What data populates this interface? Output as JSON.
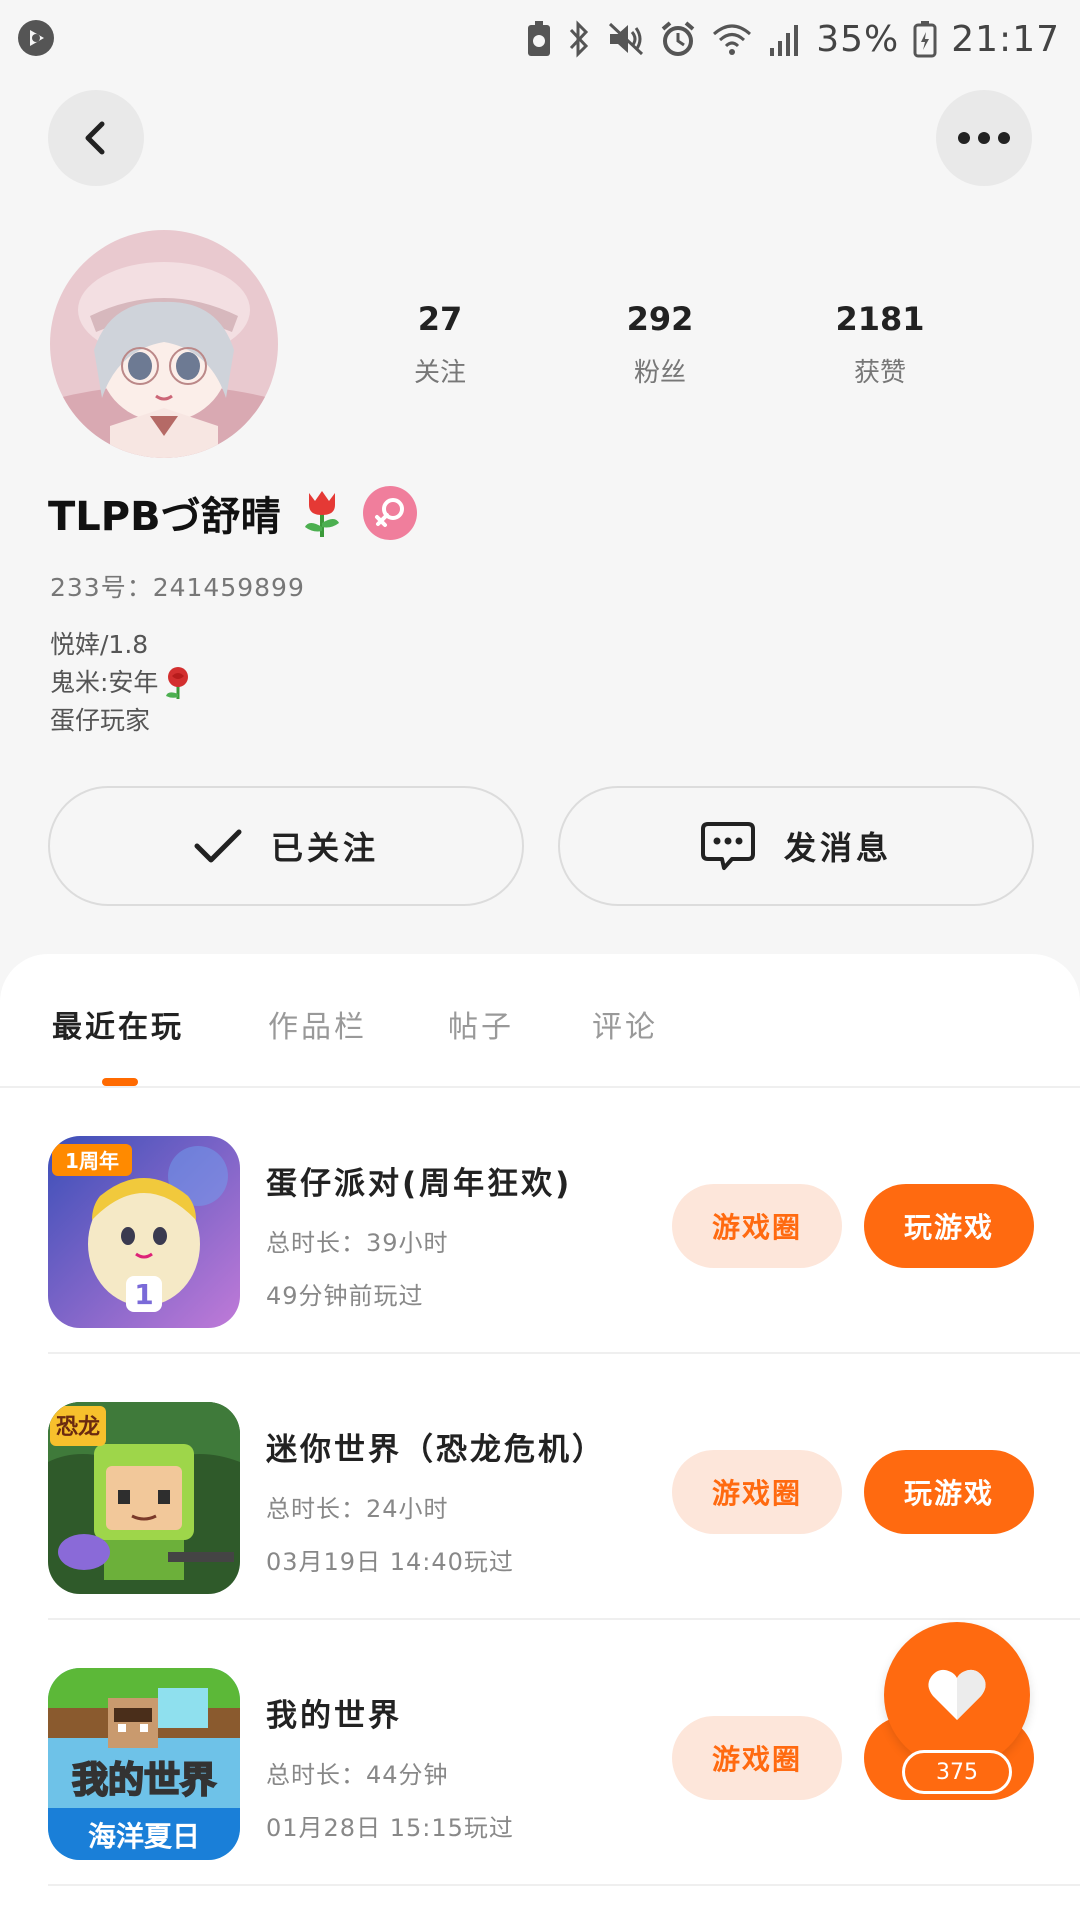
{
  "status_bar": {
    "battery": "35%",
    "time": "21:17"
  },
  "profile": {
    "following_count": "27",
    "following_label": "关注",
    "fans_count": "292",
    "fans_label": "粉丝",
    "likes_count": "2181",
    "likes_label": "获赞",
    "name": "TLPBづ舒晴",
    "uid": "233号：241459899",
    "bio": [
      "悦婞/1.8",
      "鬼米:安年",
      "蛋仔玩家"
    ]
  },
  "actions": {
    "follow_label": "已关注",
    "message_label": "发消息"
  },
  "tabs": [
    {
      "label": "最近在玩",
      "active": true
    },
    {
      "label": "作品栏",
      "active": false
    },
    {
      "label": "帖子",
      "active": false
    },
    {
      "label": "评论",
      "active": false
    }
  ],
  "games": [
    {
      "title": "蛋仔派对(周年狂欢)",
      "duration": "总时长：39小时",
      "last_played": "49分钟前玩过",
      "circle_label": "游戏圈",
      "play_label": "玩游戏",
      "icon_badge": "1周年"
    },
    {
      "title": "迷你世界（恐龙危机）",
      "duration": "总时长：24小时",
      "last_played": "03月19日 14:40玩过",
      "circle_label": "游戏圈",
      "play_label": "玩游戏",
      "icon_badge": "恐龙"
    },
    {
      "title": "我的世界",
      "duration": "总时长：44分钟",
      "last_played": "01月28日 15:15玩过",
      "circle_label": "游戏圈",
      "icon_title": "我的世界",
      "icon_subtitle": "海洋夏日"
    }
  ],
  "like_fab": {
    "count": "375"
  },
  "colors": {
    "accent": "#ff6a10",
    "accent_light": "#fde6da",
    "gender_female": "#f07e9c"
  },
  "icons": [
    "back-arrow-icon",
    "more-dots-icon",
    "check-icon",
    "chat-bubble-icon",
    "heart-icon",
    "female-icon",
    "tulip-icon",
    "rose-icon"
  ]
}
